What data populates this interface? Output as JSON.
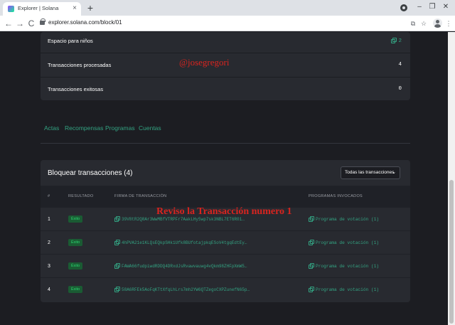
{
  "browser": {
    "tab_title": "Explorer | Solana",
    "tab_close": "×",
    "new_tab": "+",
    "url": "explorer.solana.com/block/01",
    "nav": {
      "back": "←",
      "forward": "→",
      "reload": "C"
    },
    "window": {
      "minimize": "–",
      "restore": "❐",
      "close": "✕"
    },
    "toolbar_icons": {
      "translate": "⧉",
      "bookmark": "☆",
      "menu": "⋮"
    }
  },
  "block_details": [
    {
      "label": "Espacio para niños",
      "value": "2",
      "is_link": true
    },
    {
      "label": "Transacciones procesadas",
      "value": "4",
      "is_link": false
    },
    {
      "label": "Transacciones exitosas",
      "value": "0",
      "is_link": false
    }
  ],
  "watermarks": {
    "handle": "@josegregori",
    "note": "Reviso la Transacción  numero 1"
  },
  "tabs": [
    "Actas",
    "Recompensas",
    "Programas",
    "Cuentas"
  ],
  "transactions": {
    "title": "Bloquear transacciones (4)",
    "filter": "Todas las transacciones",
    "filter_chevron": "⌄",
    "columns": {
      "index": "#",
      "result": "RESULTADO",
      "signature": "FIRMA DE TRANSACCIÓN",
      "programs": "PROGRAMAS INVOCADOS"
    },
    "rows": [
      {
        "index": "1",
        "result": "Éxito",
        "signature": "39V8tR2Q8Ar3WwMBfVTRPFr7AakLHy5wp7sk3NBL7ET6R01…",
        "programs": "Programa de votación (1)"
      },
      {
        "index": "2",
        "result": "Éxito",
        "signature": "4hPVA21e1KLQsEQkpSHk1Ufk8BUfotajpkqESoV4tgqEdtEy…",
        "programs": "Programa de votación (1)"
      },
      {
        "index": "3",
        "result": "Éxito",
        "signature": "FAWA66fudpiwdRDDQ4DRxdJsRvawvauwg4vQkm98ZHFpXmW5…",
        "programs": "Programa de votación (1)"
      },
      {
        "index": "4",
        "result": "Éxito",
        "signature": "58A6RFEk5AoFqKTtXfqLhLrs7mh2YW6QTZegoCXPZunefN65p…",
        "programs": "Programa de votación (1)"
      }
    ]
  },
  "colors": {
    "page_bg": "#1c1d22",
    "card_bg": "#282a30",
    "accent_link": "#33a382",
    "success_badge_bg": "#1a5b33",
    "success_badge_text": "#2bd56f",
    "watermark": "#d9241f"
  }
}
